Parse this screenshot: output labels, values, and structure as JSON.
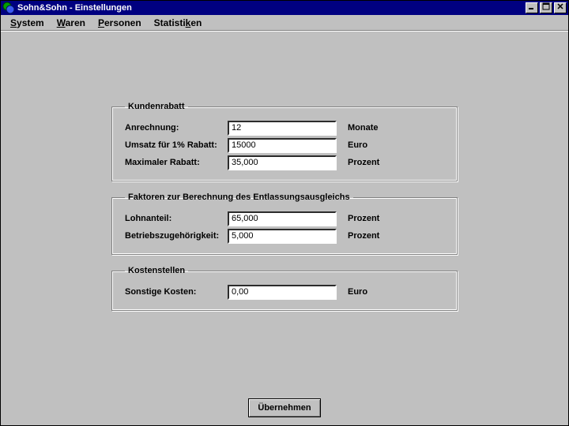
{
  "window": {
    "title": "Sohn&Sohn - Einstellungen"
  },
  "menubar": {
    "items": [
      {
        "pre": "",
        "ul": "S",
        "post": "ystem"
      },
      {
        "pre": "",
        "ul": "W",
        "post": "aren"
      },
      {
        "pre": "",
        "ul": "P",
        "post": "ersonen"
      },
      {
        "pre": "Statisti",
        "ul": "k",
        "post": "en"
      }
    ]
  },
  "groups": {
    "kundenrabatt": {
      "legend": "Kundenrabatt",
      "rows": [
        {
          "label": "Anrechnung:",
          "value": "12",
          "unit": "Monate"
        },
        {
          "label": "Umsatz für 1% Rabatt:",
          "value": "15000",
          "unit": "Euro"
        },
        {
          "label": "Maximaler Rabatt:",
          "value": "35,000",
          "unit": "Prozent"
        }
      ]
    },
    "faktoren": {
      "legend": "Faktoren zur Berechnung des Entlassungsausgleichs",
      "rows": [
        {
          "label": "Lohnanteil:",
          "value": "65,000",
          "unit": "Prozent"
        },
        {
          "label": "Betriebszugehörigkeit:",
          "value": "5,000",
          "unit": "Prozent"
        }
      ]
    },
    "kosten": {
      "legend": "Kostenstellen",
      "rows": [
        {
          "label": "Sonstige Kosten:",
          "value": "0,00",
          "unit": "Euro"
        }
      ]
    }
  },
  "buttons": {
    "apply": "Übernehmen"
  }
}
